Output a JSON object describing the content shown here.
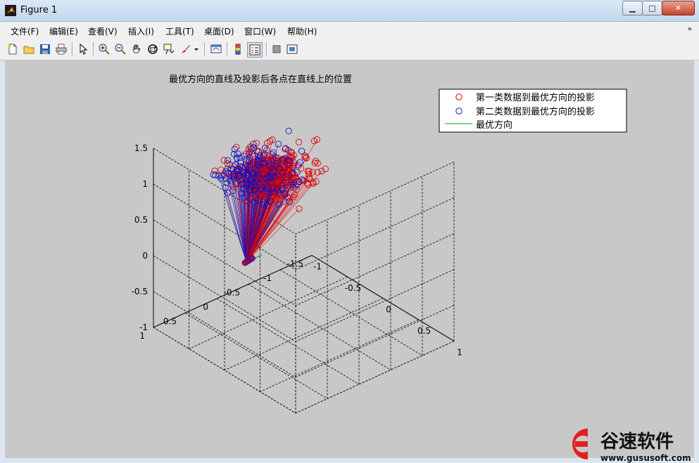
{
  "window": {
    "title": "Figure 1",
    "minimize": "▁",
    "maximize": "□",
    "close": "✕"
  },
  "menu": [
    {
      "label": "文件(F)"
    },
    {
      "label": "编辑(E)"
    },
    {
      "label": "查看(V)"
    },
    {
      "label": "插入(I)"
    },
    {
      "label": "工具(T)"
    },
    {
      "label": "桌面(D)"
    },
    {
      "label": "窗口(W)"
    },
    {
      "label": "帮助(H)"
    }
  ],
  "menu_overflow": "»",
  "toolbar": [
    {
      "icon": "new-figure-icon"
    },
    {
      "icon": "open-file-icon"
    },
    {
      "icon": "save-icon"
    },
    {
      "icon": "print-icon"
    },
    {
      "icon": "edit-plot-arrow-icon"
    },
    {
      "icon": "zoom-in-icon"
    },
    {
      "icon": "zoom-out-icon"
    },
    {
      "icon": "pan-hand-icon"
    },
    {
      "icon": "rotate-3d-icon"
    },
    {
      "icon": "data-cursor-icon"
    },
    {
      "icon": "brush-icon"
    },
    {
      "icon": "brush-dropdown-icon"
    },
    {
      "icon": "link-plot-icon"
    },
    {
      "icon": "colorbar-icon"
    },
    {
      "icon": "legend-icon"
    },
    {
      "icon": "hide-plot-tools-icon"
    },
    {
      "icon": "show-plot-tools-icon"
    }
  ],
  "colors": {
    "class1": "#dd0000",
    "class2": "#1010c0",
    "direction": "#00aa00",
    "figure_bg": "#c8c8c8"
  },
  "chart_data": {
    "type": "scatter",
    "title": "最优方向的直线及投影后各点在直线上的位置",
    "projection": "3d",
    "axes": {
      "x": {
        "ticks": [
          "-1",
          "-0.5",
          "0",
          "0.5",
          "1"
        ],
        "range": [
          -1,
          1
        ]
      },
      "y": {
        "ticks": [
          "-1.5",
          "-1",
          "-0.5",
          "0",
          "0.5",
          "1"
        ],
        "range": [
          -1.5,
          1
        ]
      },
      "z": {
        "ticks": [
          "-1",
          "-0.5",
          "0",
          "0.5",
          "1",
          "1.5"
        ],
        "range": [
          -1,
          1.5
        ]
      }
    },
    "grid": true,
    "legend_position": "top-right",
    "series": [
      {
        "name": "第一类数据到最优方向的投影",
        "marker": "o",
        "color": "#dd0000"
      },
      {
        "name": "第二类数据到最优方向的投影",
        "marker": "o",
        "color": "#1010c0"
      },
      {
        "name": "最优方向",
        "marker": "line",
        "color": "#00aa00"
      }
    ]
  },
  "watermark": {
    "brand": "谷速软件",
    "url": "www.gususoft.com"
  }
}
